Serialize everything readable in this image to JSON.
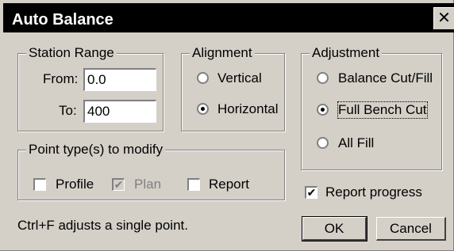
{
  "window": {
    "title": "Auto Balance",
    "close_glyph": "✕"
  },
  "station_range": {
    "legend": "Station Range",
    "from_label": "From:",
    "from_value": "0.0",
    "to_label": "To:",
    "to_value": "400"
  },
  "alignment": {
    "legend": "Alignment",
    "options": [
      "Vertical",
      "Horizontal"
    ],
    "selected": "Horizontal"
  },
  "adjustment": {
    "legend": "Adjustment",
    "options": [
      "Balance Cut/Fill",
      "Full Bench Cut",
      "All Fill"
    ],
    "selected": "Full Bench Cut"
  },
  "point_types": {
    "legend": "Point type(s) to modify",
    "items": [
      {
        "label": "Profile",
        "checked": false,
        "enabled": true
      },
      {
        "label": "Plan",
        "checked": true,
        "enabled": false
      },
      {
        "label": "Report",
        "checked": false,
        "enabled": true
      }
    ]
  },
  "report_progress": {
    "label": "Report progress",
    "checked": true
  },
  "hint": "Ctrl+F adjusts a single point.",
  "buttons": {
    "ok": "OK",
    "cancel": "Cancel"
  }
}
